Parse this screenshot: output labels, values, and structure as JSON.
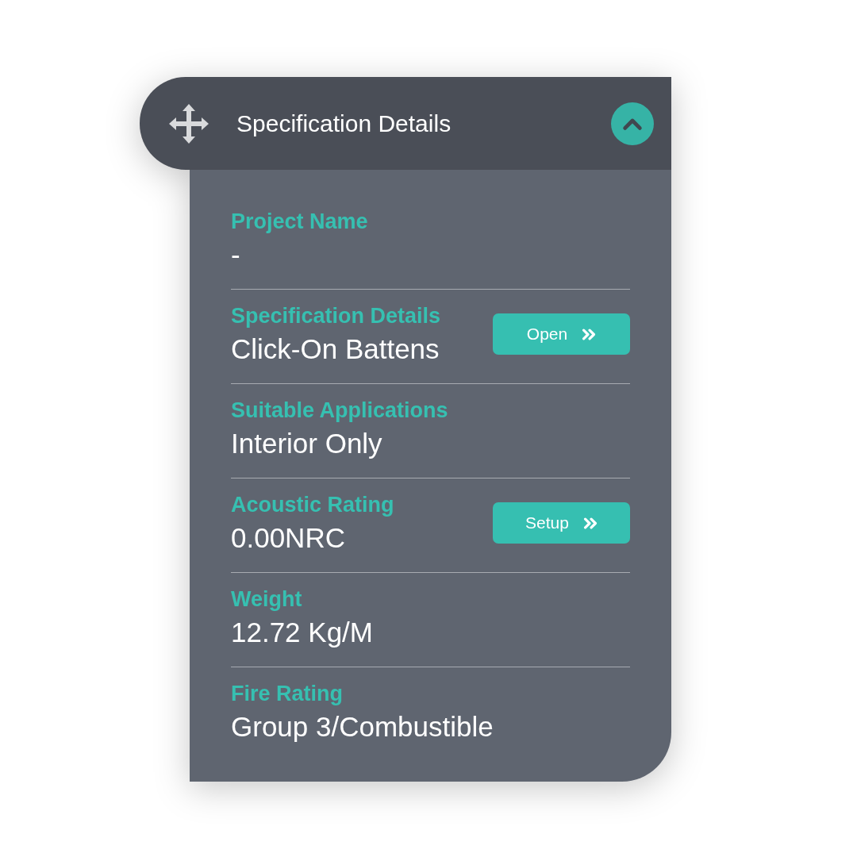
{
  "panel": {
    "title": "Specification Details",
    "expanded": true
  },
  "fields": [
    {
      "label": "Project Name",
      "value": "-"
    },
    {
      "label": "Specification Details",
      "value": "Click-On Battens",
      "button": "Open"
    },
    {
      "label": "Suitable Applications",
      "value": "Interior Only"
    },
    {
      "label": "Acoustic Rating",
      "value": "0.00NRC",
      "button": "Setup"
    },
    {
      "label": "Weight",
      "value": "12.72 Kg/M"
    },
    {
      "label": "Fire Rating",
      "value": "Group 3/Combustible"
    }
  ]
}
